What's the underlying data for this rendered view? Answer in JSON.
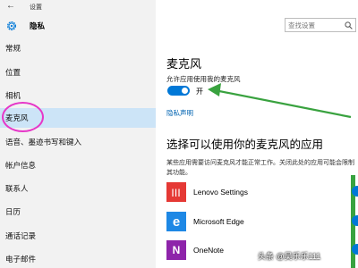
{
  "window": {
    "title": "设置",
    "back_glyph": "←"
  },
  "home": {
    "title": "隐私"
  },
  "search": {
    "placeholder": "查找设置"
  },
  "sidebar": {
    "items": [
      {
        "label": "常规"
      },
      {
        "label": "位置"
      },
      {
        "label": "相机"
      },
      {
        "label": "麦克风"
      },
      {
        "label": "语音、墨迹书写和键入"
      },
      {
        "label": "帐户信息"
      },
      {
        "label": "联系人"
      },
      {
        "label": "日历"
      },
      {
        "label": "通话记录"
      },
      {
        "label": "电子邮件"
      }
    ]
  },
  "main": {
    "title": "麦克风",
    "allow_label": "允许应用使用我的麦克风",
    "toggle_state": "开",
    "privacy_link": "隐私声明",
    "section_title": "选择可以使用你的麦克风的应用",
    "description": "某些应用需要访问麦克风才能正常工作。关闭此处的应用可能会限制其功能。",
    "apps": [
      {
        "name": "Lenovo Settings",
        "icon": "lenovo-settings-icon",
        "color": "#e53935",
        "glyph": "|||"
      },
      {
        "name": "Microsoft Edge",
        "icon": "edge-icon",
        "color": "#1e88e5",
        "glyph": "e"
      },
      {
        "name": "OneNote",
        "icon": "onenote-icon",
        "color": "#8e24aa",
        "glyph": "N"
      }
    ]
  },
  "watermark": "头条 @吴乐乐111",
  "colors": {
    "accent": "#0078d7",
    "annotation_circle": "#e637c8",
    "annotation_arrow": "#39a23f",
    "selected_bg": "#cce4f7"
  }
}
